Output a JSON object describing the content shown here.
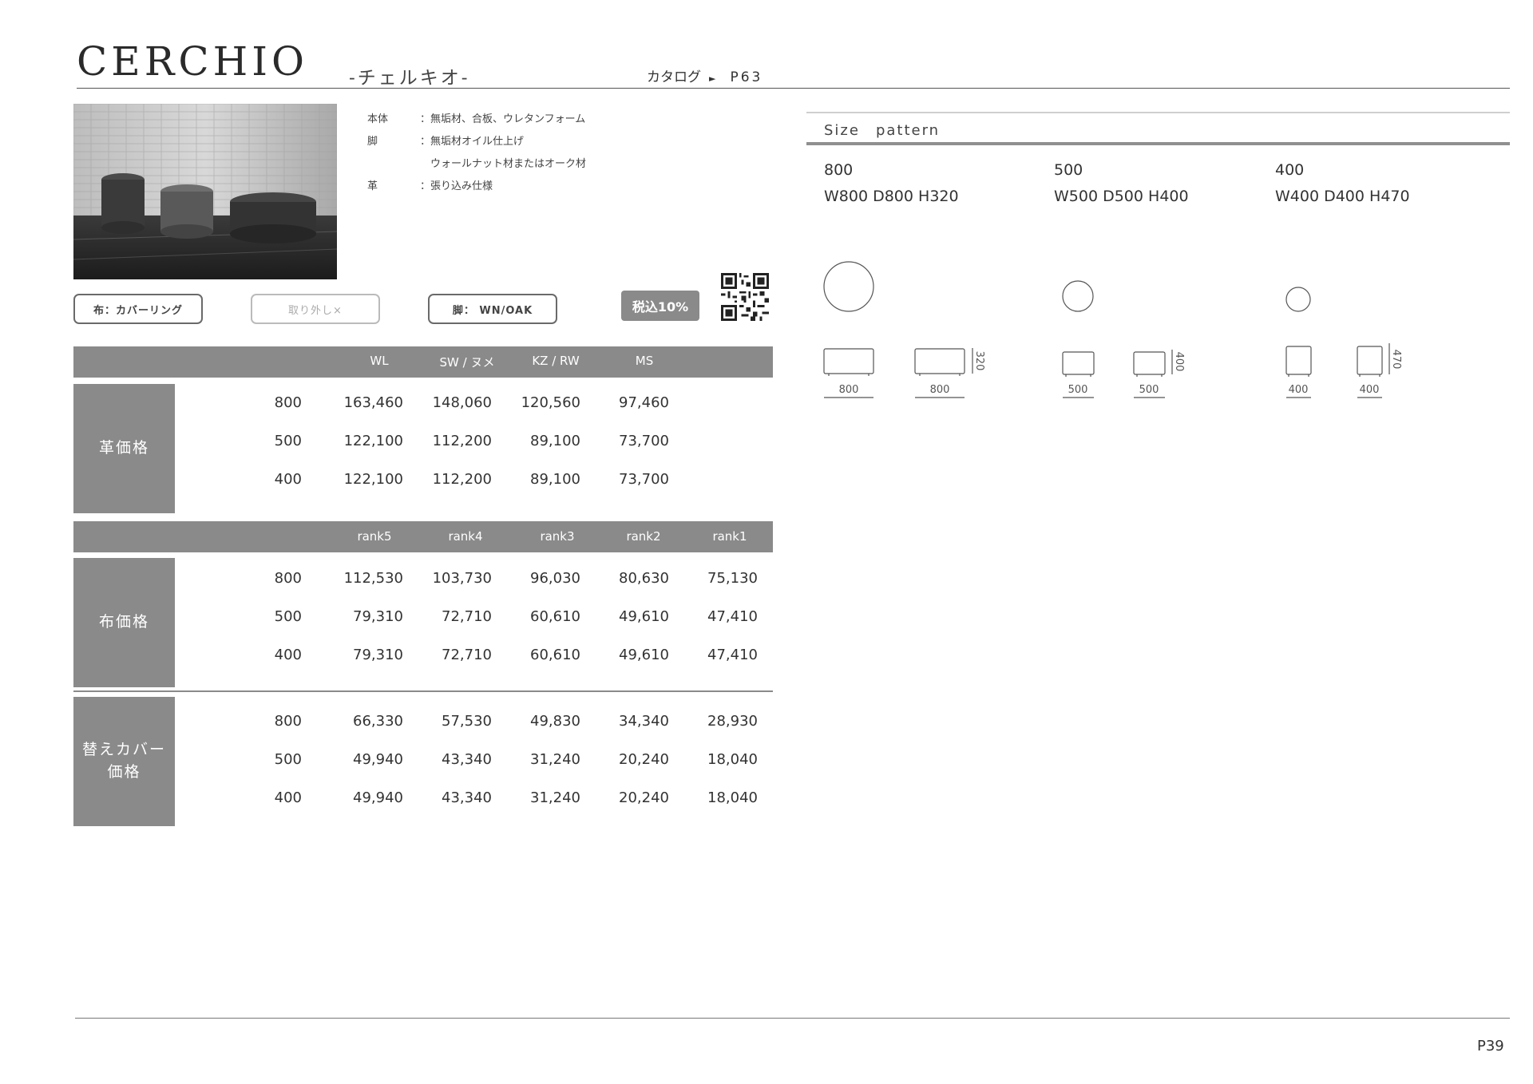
{
  "header": {
    "title": "CERCHIO",
    "subtitle": "-チェルキオ-",
    "catalog_label": "カタログ",
    "catalog_page": "P63"
  },
  "specs": [
    {
      "key": "本体",
      "value": "：無垢材、合板、ウレタンフォーム"
    },
    {
      "key": "脚",
      "value": "：無垢材オイル仕上げ"
    },
    {
      "key": "",
      "value": "　ウォールナット材またはオーク材"
    },
    {
      "key": "革",
      "value": "：張り込み仕様"
    }
  ],
  "tags": {
    "fabric": "布：カバーリング",
    "removable": "取り外し×",
    "leg": "脚： WN/OAK",
    "tax": "税込10%"
  },
  "leather_table": {
    "side_label": "革価格",
    "headers": [
      "WL",
      "SW / ヌメ",
      "KZ / RW",
      "MS"
    ],
    "rows": [
      {
        "size": "800",
        "prices": [
          "163,460",
          "148,060",
          "120,560",
          "97,460"
        ]
      },
      {
        "size": "500",
        "prices": [
          "122,100",
          "112,200",
          "89,100",
          "73,700"
        ]
      },
      {
        "size": "400",
        "prices": [
          "122,100",
          "112,200",
          "89,100",
          "73,700"
        ]
      }
    ]
  },
  "fabric_table": {
    "side_label": "布価格",
    "headers": [
      "rank5",
      "rank4",
      "rank3",
      "rank2",
      "rank1"
    ],
    "rows": [
      {
        "size": "800",
        "prices": [
          "112,530",
          "103,730",
          "96,030",
          "80,630",
          "75,130"
        ]
      },
      {
        "size": "500",
        "prices": [
          "79,310",
          "72,710",
          "60,610",
          "49,610",
          "47,410"
        ]
      },
      {
        "size": "400",
        "prices": [
          "79,310",
          "72,710",
          "60,610",
          "49,610",
          "47,410"
        ]
      }
    ]
  },
  "cover_table": {
    "side_label": "替えカバー\n価格",
    "rows": [
      {
        "size": "800",
        "prices": [
          "66,330",
          "57,530",
          "49,830",
          "34,340",
          "28,930"
        ]
      },
      {
        "size": "500",
        "prices": [
          "49,940",
          "43,340",
          "31,240",
          "20,240",
          "18,040"
        ]
      },
      {
        "size": "400",
        "prices": [
          "49,940",
          "43,340",
          "31,240",
          "20,240",
          "18,040"
        ]
      }
    ]
  },
  "size_pattern": {
    "title": "Size　pattern",
    "sizes": [
      {
        "name": "800",
        "dims": "W800 D800 H320",
        "width_label": "800",
        "height_label": "320"
      },
      {
        "name": "500",
        "dims": "W500 D500 H400",
        "width_label": "500",
        "height_label": "400"
      },
      {
        "name": "400",
        "dims": "W400 D400 H470",
        "width_label": "400",
        "height_label": "470"
      }
    ]
  },
  "footer": {
    "page": "P39"
  }
}
